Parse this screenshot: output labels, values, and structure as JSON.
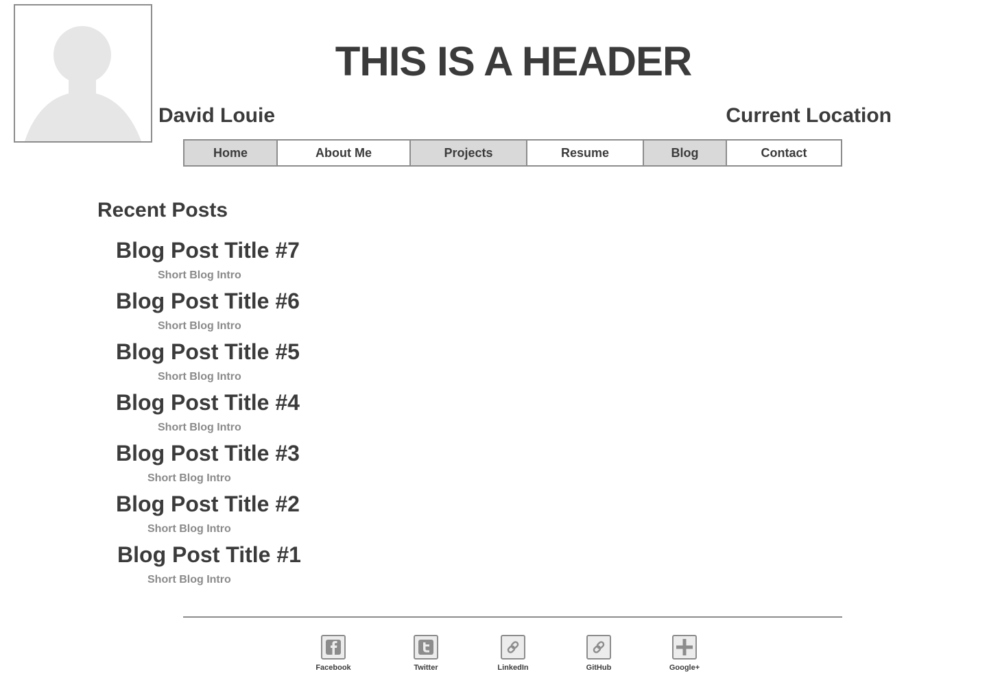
{
  "header": {
    "title": "THIS IS A HEADER",
    "name": "David Louie",
    "location": "Current Location"
  },
  "nav": {
    "items": [
      {
        "label": "Home"
      },
      {
        "label": "About Me"
      },
      {
        "label": "Projects"
      },
      {
        "label": "Resume"
      },
      {
        "label": "Blog"
      },
      {
        "label": "Contact"
      }
    ]
  },
  "recent": {
    "heading": "Recent Posts",
    "posts": [
      {
        "title": "Blog Post Title #7",
        "intro": "Short Blog Intro"
      },
      {
        "title": "Blog Post Title #6",
        "intro": "Short Blog Intro"
      },
      {
        "title": "Blog Post Title #5",
        "intro": "Short Blog Intro"
      },
      {
        "title": "Blog Post Title #4",
        "intro": "Short Blog Intro"
      },
      {
        "title": "Blog Post Title #3",
        "intro": "Short Blog Intro"
      },
      {
        "title": "Blog Post Title #2",
        "intro": "Short Blog Intro"
      },
      {
        "title": "Blog Post Title #1",
        "intro": "Short Blog Intro"
      }
    ]
  },
  "footer": {
    "social": [
      {
        "label": "Facebook",
        "icon": "facebook-icon"
      },
      {
        "label": "Twitter",
        "icon": "twitter-icon"
      },
      {
        "label": "LinkedIn",
        "icon": "link-icon"
      },
      {
        "label": "GitHub",
        "icon": "link-icon"
      },
      {
        "label": "Google+",
        "icon": "plus-icon"
      }
    ]
  },
  "colors": {
    "text": "#3b3b3b",
    "muted": "#8a8a8a",
    "border": "#8c8c8c",
    "nav_shaded": "#d9d9d9",
    "placeholder": "#e6e6e6"
  }
}
